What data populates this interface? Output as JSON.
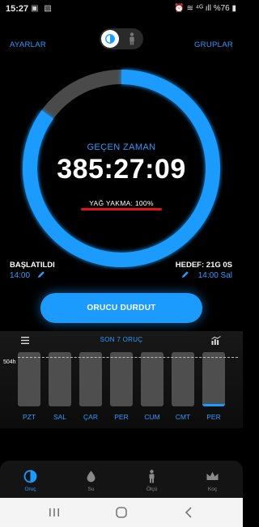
{
  "status_bar": {
    "time": "15:27",
    "battery": "%76"
  },
  "header": {
    "settings_label": "AYARLAR",
    "groups_label": "GRUPLAR",
    "mode_active": "fasting"
  },
  "timer": {
    "elapsed_label": "GEÇEN ZAMAN",
    "elapsed_value": "385:27:09",
    "fat_burn": "YAĞ YAKMA: 100%",
    "progress": 0.85
  },
  "start": {
    "title": "BAŞLATILDI",
    "time": "14:00"
  },
  "goal": {
    "title": "HEDEF: 21G 0S",
    "time": "14:00 Sal"
  },
  "stop_button": "ORUCU DURDUT",
  "history": {
    "title": "SON 7 ORUÇ",
    "hours_label": "504h",
    "days": [
      "PZT",
      "SAL",
      "ÇAR",
      "PER",
      "CUM",
      "CMT",
      "PER"
    ],
    "fill_fraction": [
      0,
      0,
      0,
      0,
      0,
      0,
      0.04
    ]
  },
  "nav": [
    {
      "label": "Oruç",
      "icon": "fasting-icon",
      "active": true
    },
    {
      "label": "Su",
      "icon": "water-drop-icon",
      "active": false
    },
    {
      "label": "Ölçü",
      "icon": "body-measure-icon",
      "active": false
    },
    {
      "label": "Koç",
      "icon": "crown-icon",
      "active": false
    }
  ],
  "colors": {
    "accent": "#1c9bff",
    "ring_track": "#4a4a4a",
    "highlight": "#e01414",
    "background": "#000000"
  }
}
